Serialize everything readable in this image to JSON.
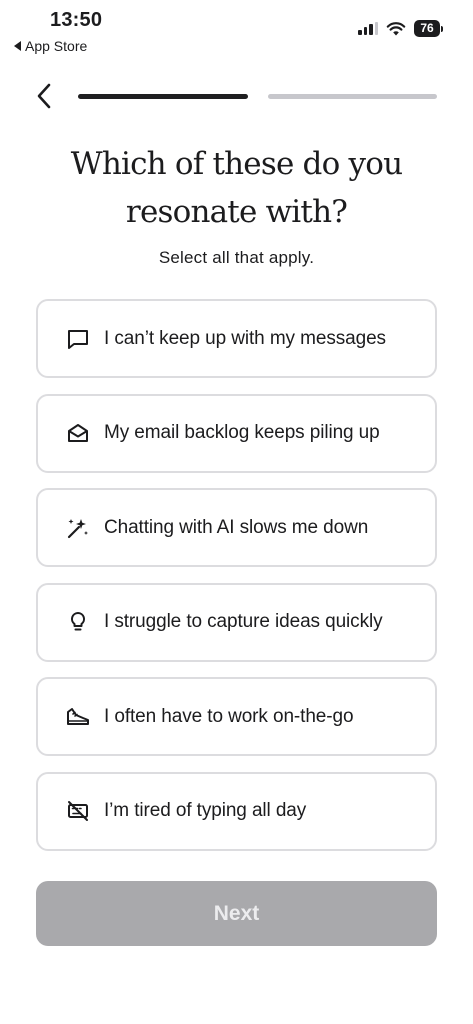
{
  "status_bar": {
    "time": "13:50",
    "back_label": "App Store",
    "battery": "76"
  },
  "header": {
    "title_line1": "Which of these do you",
    "title_line2": "resonate with?",
    "subtitle": "Select all that apply.",
    "progress_fraction": 0.5
  },
  "options": [
    {
      "label": "I can’t keep up with my messages",
      "icon": "chat-bubble-icon"
    },
    {
      "label": "My email backlog keeps piling up",
      "icon": "envelope-open-icon"
    },
    {
      "label": "Chatting with AI slows me down",
      "icon": "magic-wand-icon"
    },
    {
      "label": "I struggle to capture ideas quickly",
      "icon": "lightbulb-icon"
    },
    {
      "label": "I often have to work on-the-go",
      "icon": "sneaker-icon"
    },
    {
      "label": "I’m tired of typing all day",
      "icon": "keyboard-off-icon"
    }
  ],
  "footer": {
    "next_label": "Next"
  },
  "colors": {
    "text": "#1c1c1e",
    "option_border": "#dcdcdf",
    "progress_active": "#1f1f21",
    "progress_inactive": "#c7c7cc",
    "next_disabled_bg": "#a9a9ac"
  }
}
